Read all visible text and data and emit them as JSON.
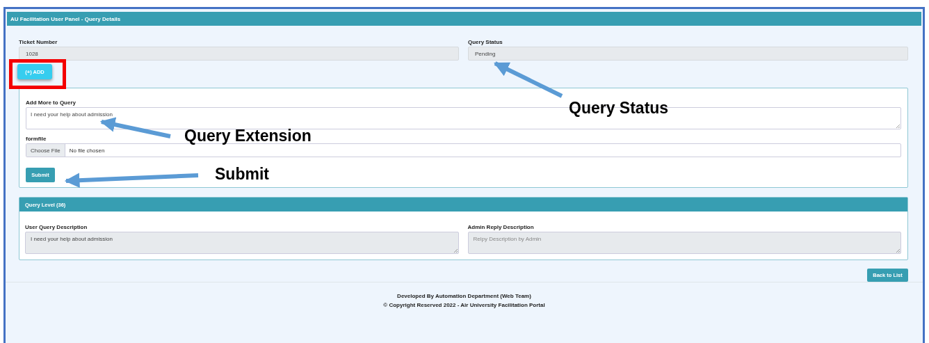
{
  "header": {
    "title": "AU Facilitation User Panel - Query Details"
  },
  "fields": [
    {
      "label": "Ticket Number",
      "value": "1028"
    },
    {
      "label": "Query Status",
      "value": "Pending"
    }
  ],
  "add_button": {
    "label": "(+) ADD",
    "highlighted": true
  },
  "extension_form": {
    "label": "Add More to Query",
    "value": "I need your help about admission",
    "file_label": "formfile",
    "file_button": "Choose File",
    "file_status": "No file chosen",
    "submit": "Submit"
  },
  "level_card": {
    "title": "Query Level (36)",
    "user_label": "User Query Description",
    "user_value": "I need your help about admission",
    "admin_label": "Admin Reply Description",
    "admin_placeholder": "Relpy Description by Admin"
  },
  "back_button": "Back to List",
  "footer": [
    "Developed By Automation Department (Web Team)",
    "© Copyright Reserved 2022 - Air University Facilitation Portal"
  ],
  "annotations": [
    {
      "text": "Query Status"
    },
    {
      "text": "Query Extension"
    },
    {
      "text": "Submit"
    }
  ]
}
